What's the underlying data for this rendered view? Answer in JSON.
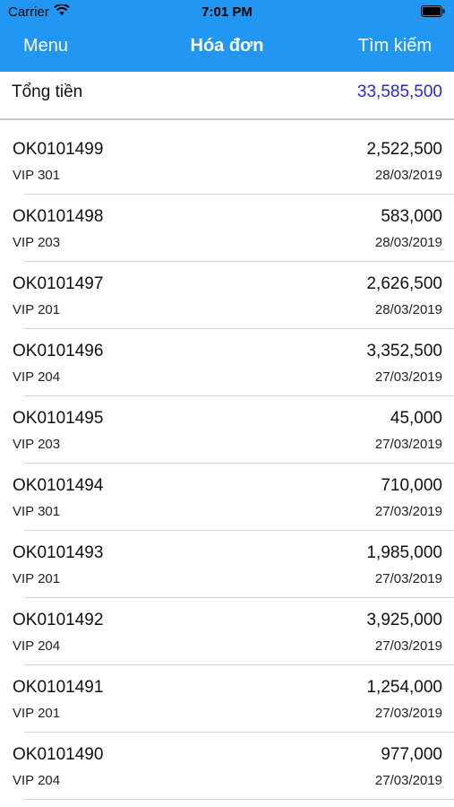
{
  "status_bar": {
    "carrier": "Carrier",
    "time": "7:01 PM",
    "icons": [
      "wifi-icon",
      "battery-icon"
    ]
  },
  "nav": {
    "left": "Menu",
    "title": "Hóa đơn",
    "right": "Tìm kiếm",
    "background_color": "#2196f3"
  },
  "summary": {
    "label": "Tổng tiền",
    "value": "33,585,500",
    "value_color": "#2a27d6"
  },
  "invoices": [
    {
      "code": "OK0101499",
      "room": "VIP 301",
      "amount": "2,522,500",
      "date": "28/03/2019"
    },
    {
      "code": "OK0101498",
      "room": "VIP 203",
      "amount": "583,000",
      "date": "28/03/2019"
    },
    {
      "code": "OK0101497",
      "room": "VIP 201",
      "amount": "2,626,500",
      "date": "28/03/2019"
    },
    {
      "code": "OK0101496",
      "room": "VIP 204",
      "amount": "3,352,500",
      "date": "27/03/2019"
    },
    {
      "code": "OK0101495",
      "room": "VIP 203",
      "amount": "45,000",
      "date": "27/03/2019"
    },
    {
      "code": "OK0101494",
      "room": "VIP 301",
      "amount": "710,000",
      "date": "27/03/2019"
    },
    {
      "code": "OK0101493",
      "room": "VIP 201",
      "amount": "1,985,000",
      "date": "27/03/2019"
    },
    {
      "code": "OK0101492",
      "room": "VIP 204",
      "amount": "3,925,000",
      "date": "27/03/2019"
    },
    {
      "code": "OK0101491",
      "room": "VIP 201",
      "amount": "1,254,000",
      "date": "27/03/2019"
    },
    {
      "code": "OK0101490",
      "room": "VIP 204",
      "amount": "977,000",
      "date": "27/03/2019"
    }
  ]
}
